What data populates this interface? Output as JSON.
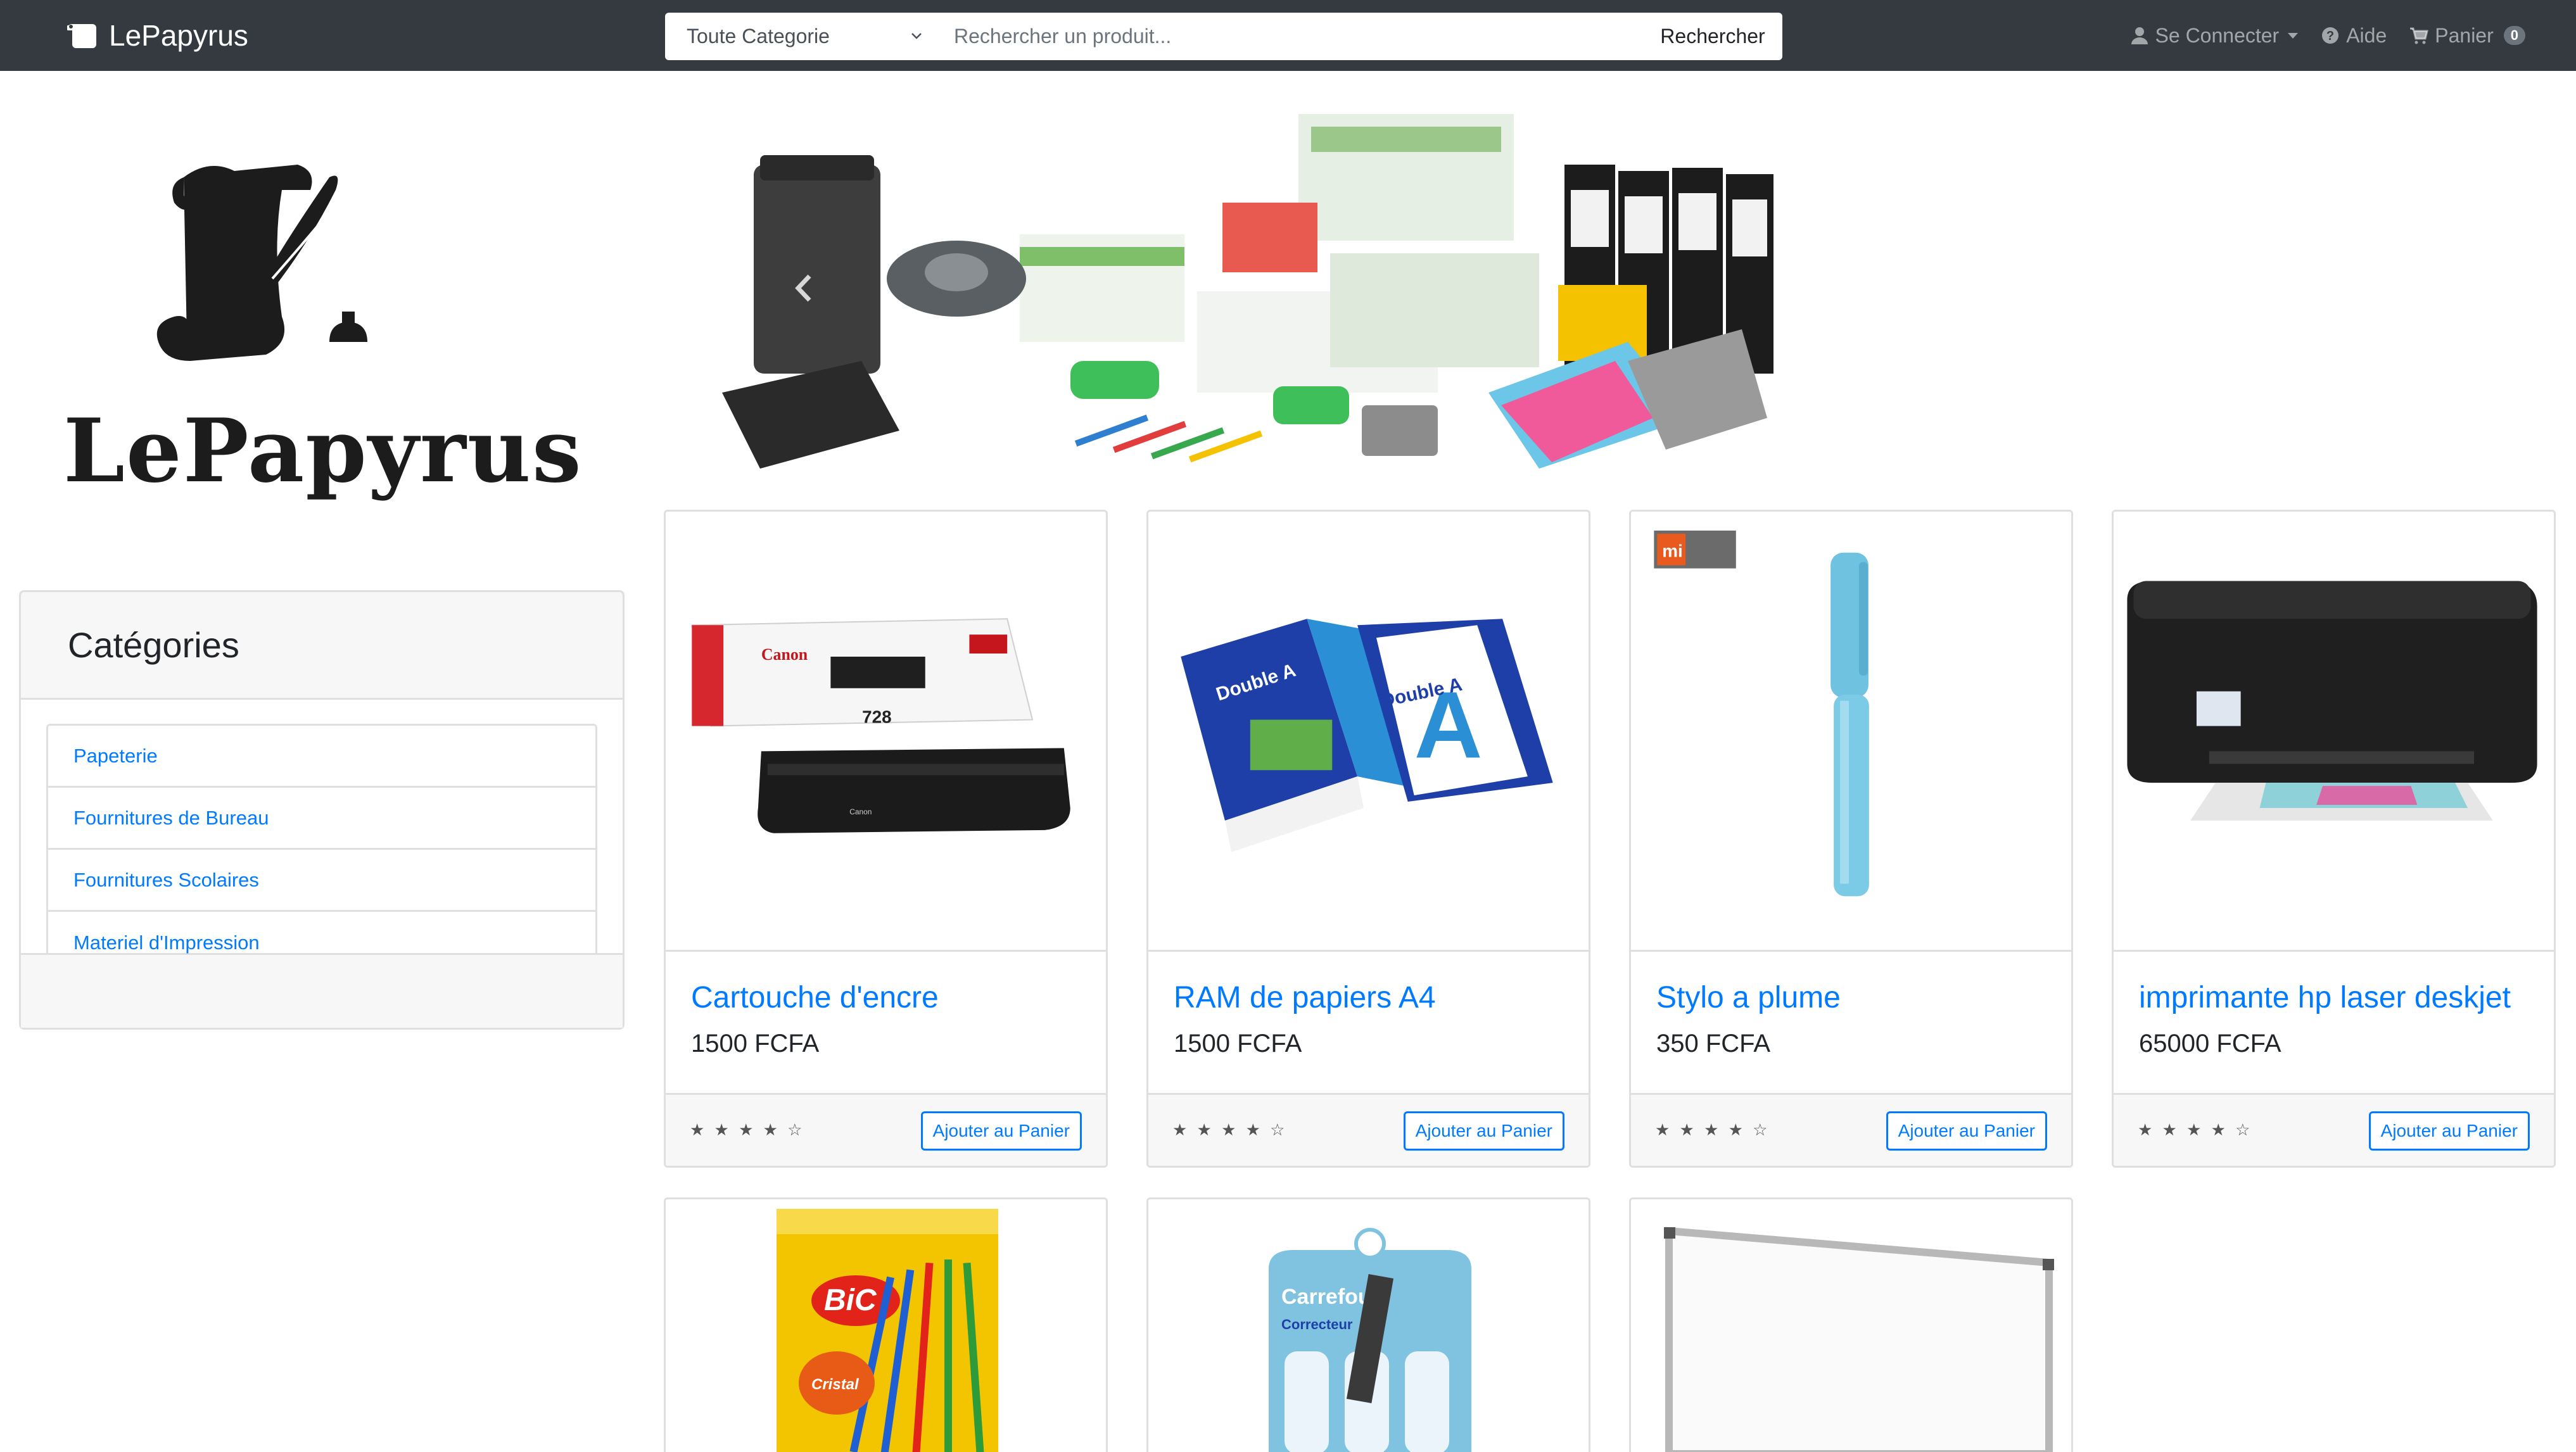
{
  "navbar": {
    "brand": "LePapyrus",
    "category_select": "Toute Categorie",
    "search_placeholder": "Rechercher un produit...",
    "search_button": "Rechercher",
    "login": "Se Connecter",
    "help": "Aide",
    "cart": "Panier",
    "cart_count": "0"
  },
  "logo": {
    "text": "LePapyrus"
  },
  "sidebar": {
    "title": "Catégories",
    "items": [
      {
        "label": "Papeterie"
      },
      {
        "label": "Fournitures de Bureau"
      },
      {
        "label": "Fournitures Scolaires"
      },
      {
        "label": "Materiel d'Impression"
      }
    ]
  },
  "products": [
    {
      "title": "Cartouche d'encre",
      "price": "1500 FCFA",
      "rating": 4,
      "add_label": "Ajouter au Panier",
      "stars": "★ ★ ★ ★ ☆"
    },
    {
      "title": "RAM de papiers A4",
      "price": "1500 FCFA",
      "rating": 4,
      "add_label": "Ajouter au Panier",
      "stars": "★ ★ ★ ★ ☆"
    },
    {
      "title": "Stylo a plume",
      "price": "350 FCFA",
      "rating": 4,
      "add_label": "Ajouter au Panier",
      "stars": "★ ★ ★ ★ ☆"
    },
    {
      "title": "imprimante hp laser deskjet",
      "price": "65000 FCFA",
      "rating": 4,
      "add_label": "Ajouter au Panier",
      "stars": "★ ★ ★ ★ ☆"
    }
  ],
  "images": {
    "toner_brand": "Canon",
    "toner_model": "728",
    "paper_brand": "Double A",
    "paper_letter": "A",
    "pen_logo": "mi",
    "pens_brand": "BiC",
    "pens_model": "Cristal",
    "corrector_brand": "Carrefour",
    "corrector_label": "Correcteur"
  },
  "colors": {
    "navbar": "#343a40",
    "link": "#007bff",
    "border": "#dfdfdf"
  }
}
